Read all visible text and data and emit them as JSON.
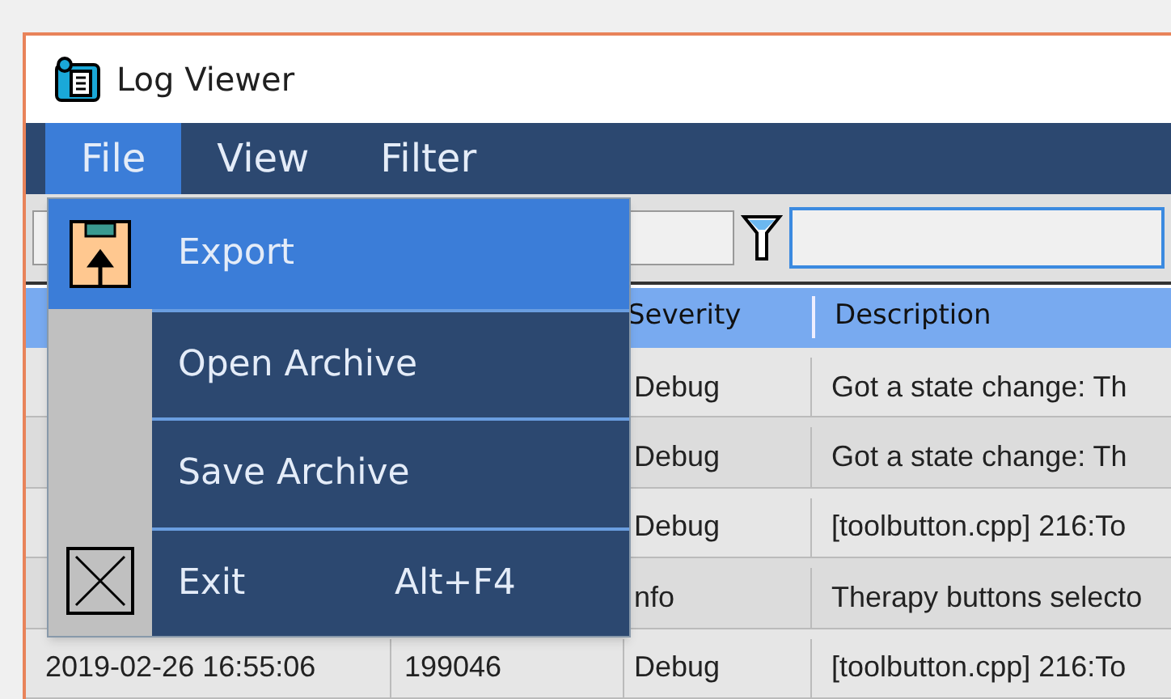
{
  "window": {
    "title": "Log Viewer"
  },
  "menu_bar": [
    {
      "label": "File",
      "selected": true
    },
    {
      "label": "View",
      "selected": false
    },
    {
      "label": "Filter",
      "selected": false
    }
  ],
  "file_menu": [
    {
      "label": "Export",
      "selected": true,
      "kind": "export"
    },
    {
      "label": "Open Archive",
      "selected": false
    },
    {
      "label": "Save Archive",
      "selected": false
    },
    {
      "label": "Exit",
      "shortcut": "Alt+F4",
      "selected": false,
      "kind": "exit"
    }
  ],
  "table": {
    "columns": [
      "Severity",
      "Description"
    ],
    "rows": [
      {
        "severity": "Debug",
        "description": "Got a state change: Th"
      },
      {
        "severity": "Debug",
        "description": "Got a state change: Th"
      },
      {
        "severity": "Debug",
        "description": "[toolbutton.cpp] 216:To"
      },
      {
        "severity": "nfo",
        "description": "Therapy buttons selecto"
      },
      {
        "time": "2019-02-26 16:55:06",
        "id": "199046",
        "severity": "Debug",
        "description": "[toolbutton.cpp] 216:To"
      }
    ]
  }
}
